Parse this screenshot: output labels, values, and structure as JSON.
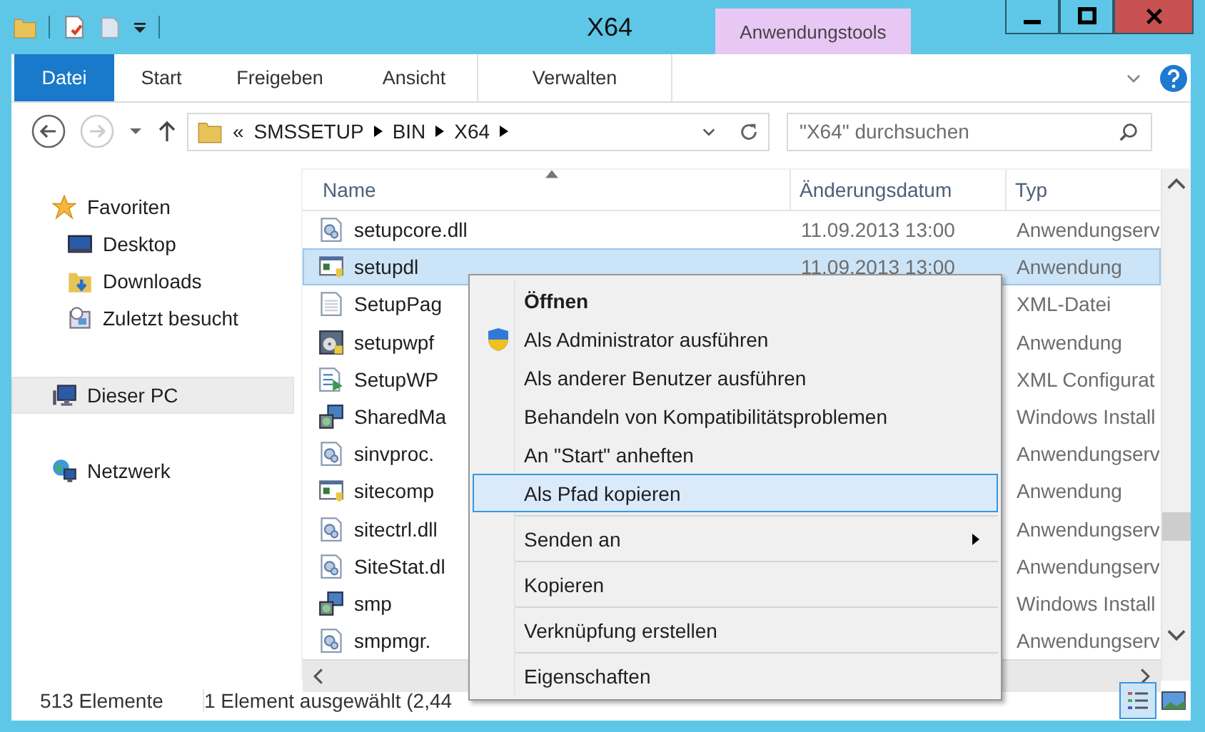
{
  "window": {
    "title": "X64",
    "contextual_group": "Anwendungstools"
  },
  "ribbon_tabs": [
    {
      "label": "Datei",
      "kind": "file",
      "selected": false
    },
    {
      "label": "Start",
      "kind": "tab",
      "selected": false
    },
    {
      "label": "Freigeben",
      "kind": "tab",
      "selected": false
    },
    {
      "label": "Ansicht",
      "kind": "tab",
      "selected": false
    },
    {
      "label": "Verwalten",
      "kind": "contextual",
      "selected": false
    }
  ],
  "address_bar": {
    "overflow": "«",
    "path": [
      "SMSSETUP",
      "BIN",
      "X64"
    ]
  },
  "search": {
    "placeholder": "\"X64\" durchsuchen"
  },
  "navigation": [
    {
      "label": "Favoriten",
      "kind": "favorites",
      "selected": false,
      "children": [
        {
          "label": "Desktop",
          "kind": "desktop",
          "selected": false
        },
        {
          "label": "Downloads",
          "kind": "downloads",
          "selected": false
        },
        {
          "label": "Zuletzt besucht",
          "kind": "recent",
          "selected": false
        }
      ]
    },
    {
      "label": "Dieser PC",
      "kind": "pc",
      "selected": true
    },
    {
      "label": "Netzwerk",
      "kind": "network",
      "selected": false
    }
  ],
  "file_list": {
    "columns": [
      "Name",
      "Änderungsdatum",
      "Typ"
    ],
    "rows": [
      {
        "name": "setupcore.dll",
        "date": "11.09.2013 13:00",
        "type": "Anwendungserv",
        "kind": "dll",
        "selected": false
      },
      {
        "name": "setupdl",
        "date": "11.09.2013 13:00",
        "type": "Anwendung",
        "kind": "app",
        "selected": true
      },
      {
        "name": "SetupPag",
        "type": "XML-Datei",
        "kind": "doc",
        "selected": false
      },
      {
        "name": "setupwpf",
        "type": "Anwendung",
        "kind": "disc",
        "selected": false
      },
      {
        "name": "SetupWP",
        "type": "XML Configurat",
        "kind": "config",
        "selected": false
      },
      {
        "name": "SharedMa",
        "type": "Windows Install",
        "kind": "msi",
        "selected": false
      },
      {
        "name": "sinvproc.",
        "type": "Anwendungserv",
        "kind": "dll",
        "selected": false
      },
      {
        "name": "sitecomp",
        "type": "Anwendung",
        "kind": "app",
        "selected": false
      },
      {
        "name": "sitectrl.dll",
        "type": "Anwendungserv",
        "kind": "dll",
        "selected": false
      },
      {
        "name": "SiteStat.dl",
        "type": "Anwendungserv",
        "kind": "dll",
        "selected": false
      },
      {
        "name": "smp",
        "type": "Windows Install",
        "kind": "msi",
        "selected": false
      },
      {
        "name": "smpmgr.",
        "type": "Anwendungserv",
        "kind": "dll",
        "selected": false
      }
    ]
  },
  "status_bar": {
    "count": "513 Elemente",
    "selection": "1 Element ausgewählt (2,44"
  },
  "context_menu": [
    {
      "kind": "item",
      "label": "Öffnen",
      "default": true,
      "shield": false,
      "submenu": false,
      "selected": false
    },
    {
      "kind": "item",
      "label": "Als Administrator ausführen",
      "default": false,
      "shield": true,
      "submenu": false,
      "selected": false
    },
    {
      "kind": "item",
      "label": "Als anderer Benutzer ausführen",
      "default": false,
      "shield": false,
      "submenu": false,
      "selected": false
    },
    {
      "kind": "item",
      "label": "Behandeln von Kompatibilitätsproblemen",
      "default": false,
      "shield": false,
      "submenu": false,
      "selected": false
    },
    {
      "kind": "item",
      "label": "An \"Start\" anheften",
      "default": false,
      "shield": false,
      "submenu": false,
      "selected": false
    },
    {
      "kind": "item",
      "label": "Als Pfad kopieren",
      "default": false,
      "shield": false,
      "submenu": false,
      "selected": true
    },
    {
      "kind": "separator"
    },
    {
      "kind": "item",
      "label": "Senden an",
      "default": false,
      "shield": false,
      "submenu": true,
      "selected": false
    },
    {
      "kind": "separator"
    },
    {
      "kind": "item",
      "label": "Kopieren",
      "default": false,
      "shield": false,
      "submenu": false,
      "selected": false
    },
    {
      "kind": "separator"
    },
    {
      "kind": "item",
      "label": "Verknüpfung erstellen",
      "default": false,
      "shield": false,
      "submenu": false,
      "selected": false
    },
    {
      "kind": "separator"
    },
    {
      "kind": "item",
      "label": "Eigenschaften",
      "default": false,
      "shield": false,
      "submenu": false,
      "selected": false
    }
  ]
}
